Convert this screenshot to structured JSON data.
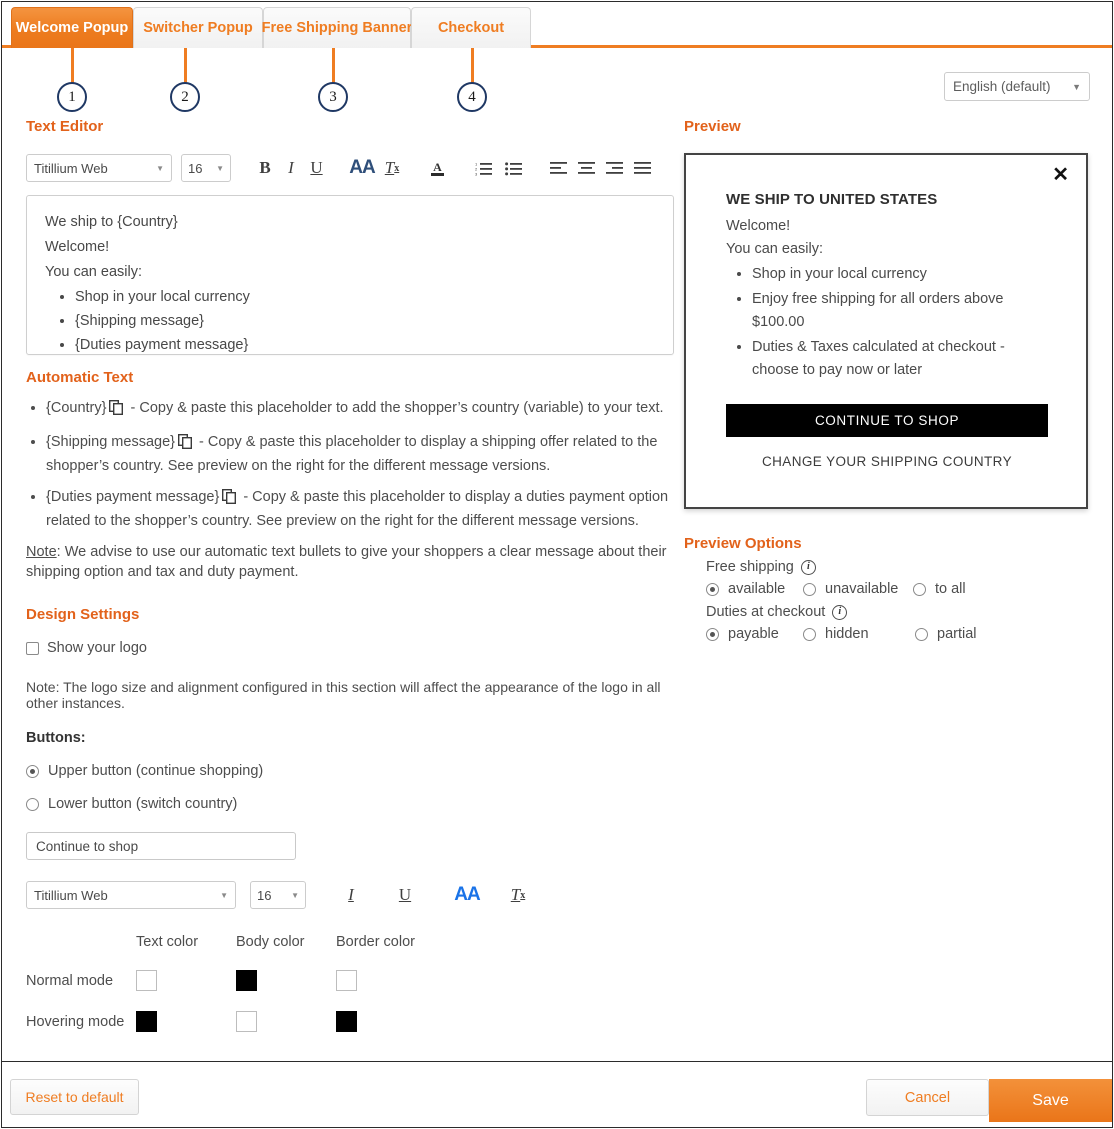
{
  "tabs": [
    {
      "label": "Welcome Popup",
      "active": true,
      "callout": "1"
    },
    {
      "label": "Switcher Popup",
      "active": false,
      "callout": "2"
    },
    {
      "label": "Free Shipping Banner",
      "active": false,
      "callout": "3"
    },
    {
      "label": "Checkout",
      "active": false,
      "callout": "4"
    }
  ],
  "language": {
    "value": "English (default)",
    "caret": "▼"
  },
  "text_editor": {
    "heading": "Text Editor",
    "toolbar": {
      "font": "Titillium Web",
      "size": "16",
      "caret": "▼",
      "bold": "B",
      "italic": "I",
      "underline": "U",
      "font_size_aa": "AA",
      "clear_format": "Tx",
      "text_color": "A",
      "ordered_list": "ol",
      "unordered_list": "ul",
      "align_left": "left",
      "align_center": "center",
      "align_right": "right",
      "align_justify": "justify"
    },
    "content": {
      "line1": "We ship to {Country}",
      "line2": "Welcome!",
      "line3": "You can easily:",
      "bullets": [
        "Shop in your local currency",
        "{Shipping message}",
        "{Duties payment message}"
      ]
    }
  },
  "automatic_text": {
    "heading": "Automatic Text",
    "items": [
      {
        "token": "{Country}",
        "desc": " - Copy & paste this placeholder to add the shopper’s country (variable) to your text."
      },
      {
        "token": "{Shipping message}",
        "desc": " - Copy & paste this placeholder to display a shipping offer related to the shopper’s country. See preview on the right for the different message versions."
      },
      {
        "token": "{Duties payment message}",
        "desc": " - Copy & paste this placeholder to display a duties payment option related to the shopper’s country. See preview on the right for the different message versions."
      }
    ],
    "note_label": "Note",
    "note_text": ": We advise to use our automatic text bullets to give your shoppers a clear message about their shipping option and tax and duty payment."
  },
  "design_settings": {
    "heading": "Design Settings",
    "show_logo": {
      "label": "Show your logo",
      "checked": false
    },
    "logo_note": "Note: The logo size and alignment configured in this section will affect the appearance of the logo in all other instances.",
    "buttons_label": "Buttons:",
    "button_options": [
      {
        "label": "Upper button (continue shopping)",
        "checked": true
      },
      {
        "label": "Lower button (switch country)",
        "checked": false
      }
    ],
    "button_text": "Continue to shop",
    "button_toolbar": {
      "font": "Titillium Web",
      "size": "16",
      "caret": "▼",
      "italic": "I",
      "underline": "U",
      "font_size_aa": "AA",
      "clear_format": "Tx"
    },
    "colors": {
      "columns": [
        "Text color",
        "Body color",
        "Border color"
      ],
      "rows": [
        {
          "label": "Normal mode",
          "swatches": [
            "#ffffff",
            "#000000",
            "#ffffff"
          ]
        },
        {
          "label": "Hovering mode",
          "swatches": [
            "#000000",
            "#ffffff",
            "#000000"
          ]
        }
      ]
    }
  },
  "preview": {
    "heading": "Preview",
    "close": "✕",
    "title": "WE SHIP TO UNITED STATES",
    "line1": "Welcome!",
    "line2": "You can easily:",
    "bullets": [
      "Shop in your local currency",
      "Enjoy free shipping for all orders above $100.00",
      "Duties & Taxes calculated at checkout - choose to pay now or later"
    ],
    "cta": "CONTINUE TO SHOP",
    "link": "CHANGE YOUR SHIPPING COUNTRY"
  },
  "preview_options": {
    "heading": "Preview Options",
    "info_glyph": "i",
    "groups": [
      {
        "label": "Free shipping",
        "options": [
          {
            "label": "available",
            "checked": true
          },
          {
            "label": "unavailable",
            "checked": false
          },
          {
            "label": "to all",
            "checked": false
          }
        ]
      },
      {
        "label": "Duties at checkout",
        "options": [
          {
            "label": "payable",
            "checked": true
          },
          {
            "label": "hidden",
            "checked": false
          },
          {
            "label": "partial",
            "checked": false
          }
        ]
      }
    ]
  },
  "footer": {
    "reset": "Reset to default",
    "cancel": "Cancel",
    "save": "Save"
  },
  "colors": {
    "accent": "#ef7d22",
    "heading": "#e2621b",
    "callout_ring": "#1f3864",
    "aa_blue": "#1a73e8"
  }
}
